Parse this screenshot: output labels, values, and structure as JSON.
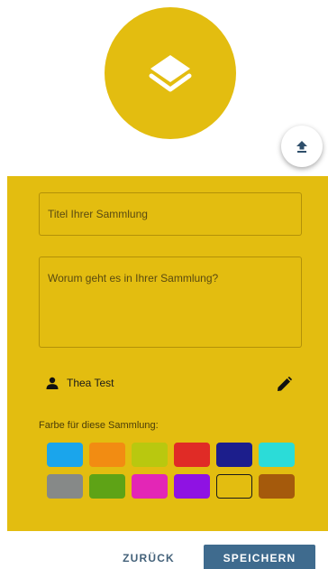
{
  "colors": {
    "accent": "#e3bd10",
    "primary_button": "#3f6b8e",
    "text_button": "#44627a"
  },
  "header": {
    "collection_icon": "layers-icon",
    "upload_icon": "upload-icon"
  },
  "form": {
    "title_placeholder": "Titel Ihrer Sammlung",
    "description_placeholder": "Worum geht es in Ihrer Sammlung?",
    "owner": {
      "icon": "person-icon",
      "name": "Thea Test",
      "edit_icon": "pencil-icon"
    },
    "color_label": "Farbe für diese Sammlung:",
    "swatches": [
      {
        "color": "#1aa5ec",
        "selected": false
      },
      {
        "color": "#f28c12",
        "selected": false
      },
      {
        "color": "#b9c80f",
        "selected": false
      },
      {
        "color": "#e02b26",
        "selected": false
      },
      {
        "color": "#1c1e8c",
        "selected": false
      },
      {
        "color": "#2bdcd8",
        "selected": false
      },
      {
        "color": "#868988",
        "selected": false
      },
      {
        "color": "#5ea316",
        "selected": false
      },
      {
        "color": "#e326b6",
        "selected": false
      },
      {
        "color": "#8f12e3",
        "selected": false
      },
      {
        "color": "#e3bd10",
        "selected": true
      },
      {
        "color": "#a55a0c",
        "selected": false
      }
    ]
  },
  "footer": {
    "back_label": "ZURÜCK",
    "save_label": "SPEICHERN"
  }
}
